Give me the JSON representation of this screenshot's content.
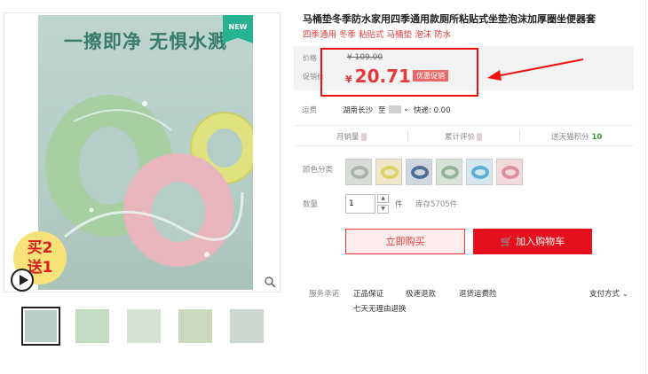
{
  "product": {
    "title": "马桶垫冬季防水家用四季通用款厕所粘贴式坐垫泡沫加厚圈坐便器套",
    "subtitle": "四季通用 冬季 粘贴式 马桶垫 泡沫 防水"
  },
  "gallery": {
    "banner_text": "一擦即净 无惧水溅",
    "new_badge": "NEW",
    "promo_badge_line1": "买2",
    "promo_badge_line2": "送1",
    "thumb_count": 5
  },
  "price": {
    "price_label": "价格",
    "promo_label": "促销价",
    "original": "¥ 109.00",
    "currency": "¥",
    "promo_value": "20.71",
    "promo_tag": "优惠促销"
  },
  "shipping": {
    "label": "运费",
    "from": "湖南长沙",
    "to_label": "至",
    "express": "快递: 0.00"
  },
  "stats": {
    "monthly_sales_label": "月销量",
    "reviews_label": "累计评价",
    "points_label": "送天猫积分",
    "points_value": "10"
  },
  "color": {
    "label": "颜色分类",
    "swatches": [
      {
        "bg": "#d7dcd6",
        "ring": "#a9b3aa"
      },
      {
        "bg": "#efe7c8",
        "ring": "#e0d16a"
      },
      {
        "bg": "#cfd6df",
        "ring": "#4d6f9a"
      },
      {
        "bg": "#d9e2d8",
        "ring": "#95b29a"
      },
      {
        "bg": "#d6e6ef",
        "ring": "#5bb0d8"
      },
      {
        "bg": "#f2dadd",
        "ring": "#df8f9f"
      }
    ]
  },
  "quantity": {
    "label": "数量",
    "value": "1",
    "unit": "件",
    "stock": "库存5705件"
  },
  "actions": {
    "buy_now": "立即购买",
    "add_cart": "加入购物车"
  },
  "services": {
    "label": "服务承诺",
    "items": [
      "正品保证",
      "极速退款",
      "退货运费险",
      "七天无理由退换"
    ],
    "pay": "支付方式"
  },
  "colors": {
    "accent": "#e4393c",
    "cart_red": "#e5101d",
    "annotation_red": "#ee1111"
  }
}
